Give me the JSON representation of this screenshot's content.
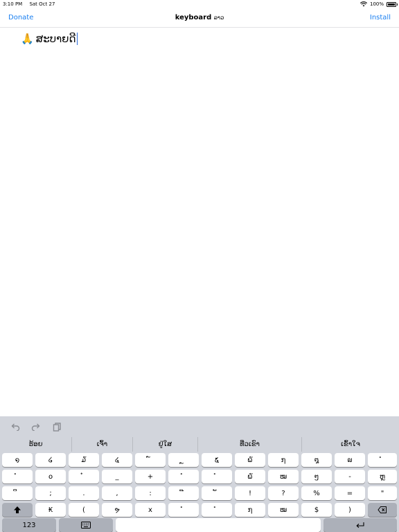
{
  "status_bar": {
    "time": "3:10 PM",
    "date": "Sat Oct 27",
    "battery": "100%"
  },
  "nav": {
    "left_button": "Donate",
    "title": "keyboard",
    "title_lao": "ລາວ",
    "right_button": "Install"
  },
  "document": {
    "emoji": "🙏",
    "text": "ສະບາຍດີ"
  },
  "toolbar": {
    "undo_icon": "undo-icon",
    "redo_icon": "redo-icon",
    "paste_icon": "clipboard-icon"
  },
  "suggestions": [
    "ຮ້ອຍ",
    "ເຈົ້າ",
    "ຢູ່ໃສ",
    "ທີ່ວເຂົາ",
    "ເຂົ້າໃຈ"
  ],
  "rows": [
    [
      "໑",
      "໒",
      "໓",
      "໔",
      "໌",
      "ຼ",
      "໕",
      "໖",
      "໗",
      "໘",
      "໙",
      "ໍ"
    ],
    [
      "ໍ",
      "໐",
      "໋",
      "_",
      "+",
      "ໍ",
      "ໍ",
      "໖",
      "ໝ",
      "ໆ",
      "-",
      "ຫຼ"
    ],
    [
      "ິ",
      ";",
      ".",
      ",",
      ":",
      "໊",
      "ັ",
      "!",
      "?",
      "%",
      "=",
      "\""
    ],
    [
      "₭",
      "(",
      "ຯ",
      "x",
      "ໍ",
      "ໍ",
      "໗",
      "ໝ",
      "$",
      ")"
    ]
  ],
  "bottom": {
    "numbers_label": "123",
    "keyboard_icon": "keyboard-icon",
    "return_icon": "return-icon",
    "shift_icon": "shift-icon",
    "delete_icon": "delete-icon"
  }
}
